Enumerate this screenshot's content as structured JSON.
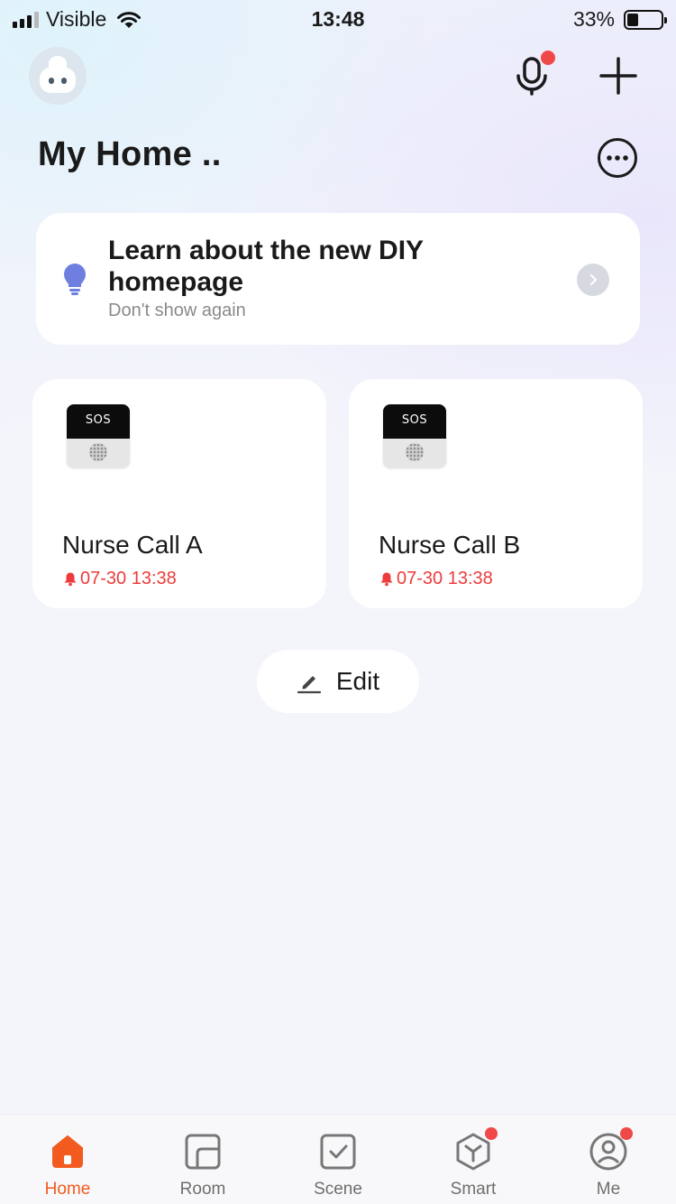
{
  "status_bar": {
    "carrier": "Visible",
    "time": "13:48",
    "battery": "33%",
    "battery_level": 0.33
  },
  "header": {
    "title": "My Home ..",
    "avatar_icon": "robot-avatar-icon",
    "mic_icon": "microphone-icon",
    "add_icon": "plus-icon",
    "more_icon": "more-icon"
  },
  "banner": {
    "title": "Learn about the new DIY homepage",
    "subtitle": "Don't show again",
    "icon": "lightbulb-icon"
  },
  "devices": [
    {
      "name": "Nurse Call A",
      "alarm": "07-30 13:38",
      "screen_text": "SOS"
    },
    {
      "name": "Nurse Call B",
      "alarm": "07-30 13:38",
      "screen_text": "SOS"
    }
  ],
  "edit": {
    "label": "Edit"
  },
  "nav": [
    {
      "label": "Home",
      "icon": "home-icon",
      "active": true
    },
    {
      "label": "Room",
      "icon": "room-icon",
      "active": false
    },
    {
      "label": "Scene",
      "icon": "scene-icon",
      "active": false
    },
    {
      "label": "Smart",
      "icon": "smart-icon",
      "active": false
    },
    {
      "label": "Me",
      "icon": "profile-icon",
      "active": false
    }
  ],
  "colors": {
    "accent": "#f25a1f",
    "alarm": "#ee3b3b",
    "notification_dot": "#f04848",
    "bulb": "#6f7fe0"
  }
}
